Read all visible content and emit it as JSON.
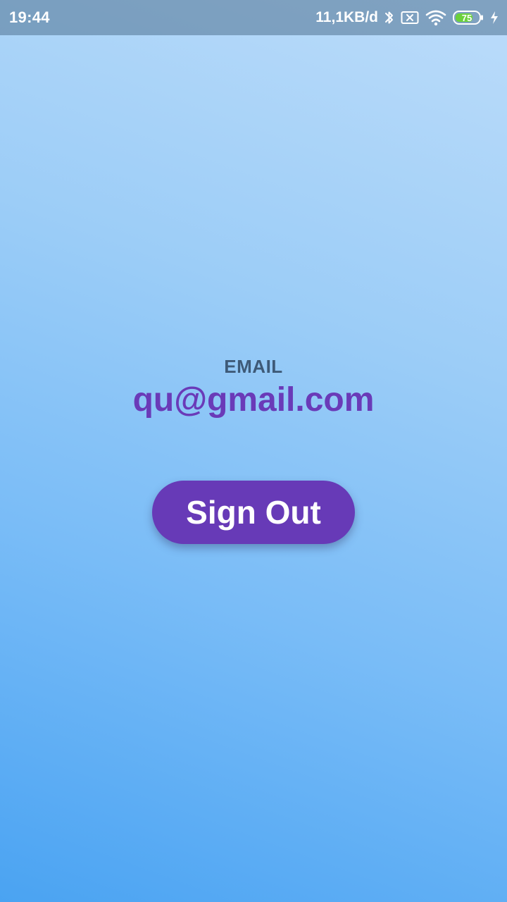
{
  "status_bar": {
    "time": "19:44",
    "net_speed": "11,1KB/d",
    "battery_level": "75",
    "icons": [
      "bluetooth-icon",
      "no-sim-icon",
      "wifi-icon",
      "battery-icon",
      "charging-icon"
    ],
    "battery_fill_color": "#6bd13a"
  },
  "profile": {
    "email_label": "EMAIL",
    "email_value": "qu@gmail.com"
  },
  "actions": {
    "sign_out_label": "Sign Out"
  },
  "colors": {
    "accent": "#673ab7",
    "label": "#3e5a78"
  }
}
